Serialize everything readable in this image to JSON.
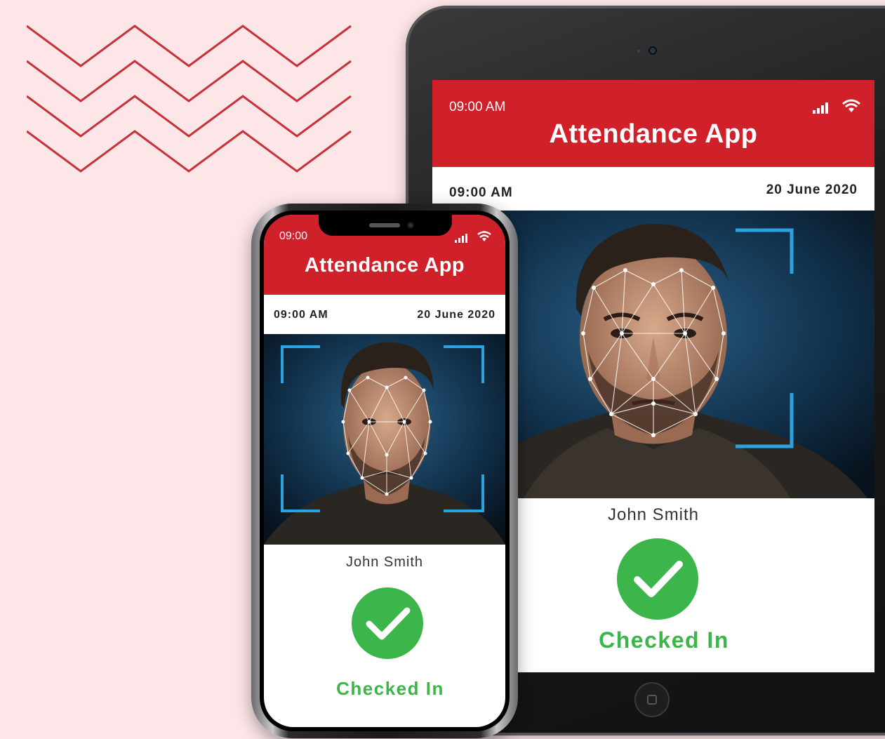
{
  "colors": {
    "background": "#fde6e8",
    "brand_red": "#d0202a",
    "success_green": "#3cb54a",
    "scan_frame_blue": "#2aa3e0",
    "zigzag_red": "#c8303a"
  },
  "tablet": {
    "status_time": "09:00 AM",
    "app_title": "Attendance App",
    "time": "09:00 AM",
    "date": "20 June 2020",
    "person_name": "John Smith",
    "check_status": "Checked In",
    "icons": [
      "signal-icon",
      "wifi-icon",
      "checkmark-icon",
      "home-button-icon",
      "camera-icon"
    ]
  },
  "phone": {
    "status_time": "09:00",
    "app_title": "Attendance App",
    "time": "09:00 AM",
    "date": "20 June 2020",
    "person_name": "John Smith",
    "check_status": "Checked In",
    "icons": [
      "signal-icon",
      "wifi-icon",
      "checkmark-icon"
    ]
  }
}
